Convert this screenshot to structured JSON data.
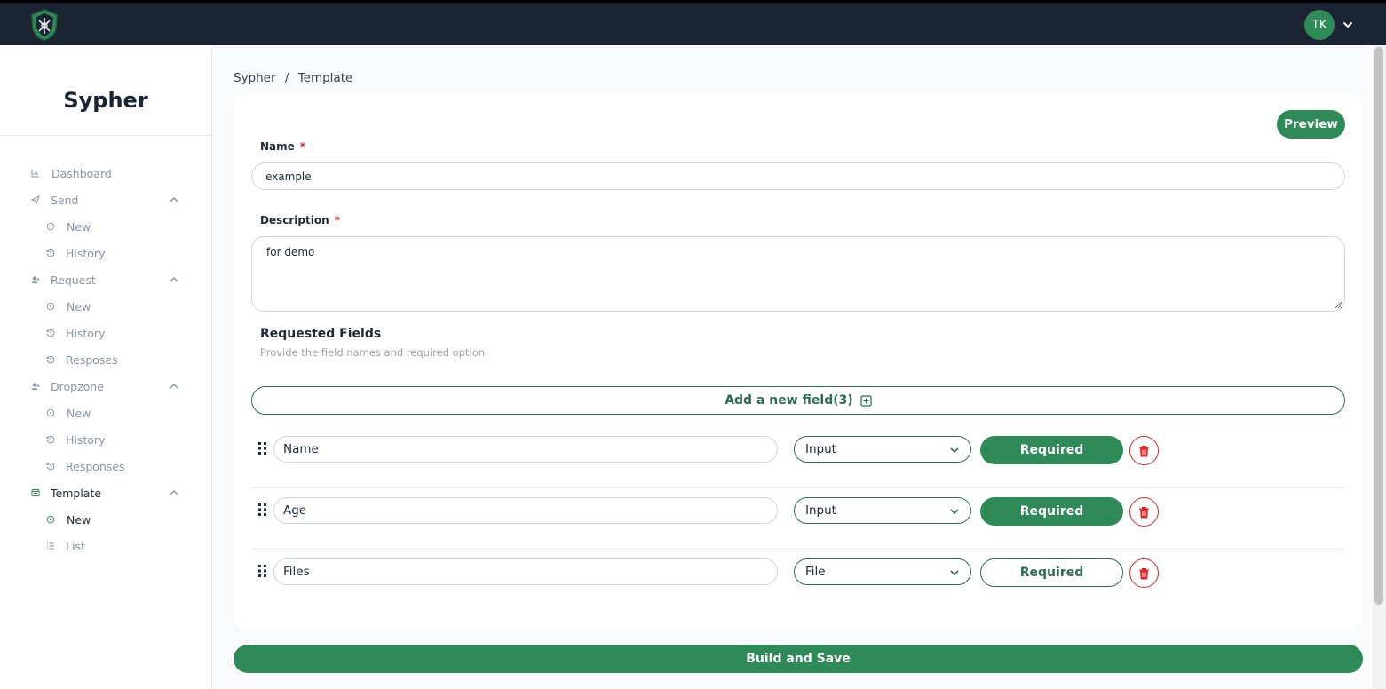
{
  "header": {
    "avatar_initials": "TK"
  },
  "sidebar": {
    "brand": "Sypher",
    "items": [
      {
        "label": "Dashboard",
        "icon": "chart-icon"
      },
      {
        "label": "Send",
        "icon": "send-icon"
      },
      {
        "label": "New",
        "icon": "plus-circle-icon"
      },
      {
        "label": "History",
        "icon": "history-icon"
      },
      {
        "label": "Request",
        "icon": "user-add-icon"
      },
      {
        "label": "New",
        "icon": "plus-circle-icon"
      },
      {
        "label": "History",
        "icon": "history-icon"
      },
      {
        "label": "Resposes",
        "icon": "history-icon"
      },
      {
        "label": "Dropzone",
        "icon": "user-add-icon"
      },
      {
        "label": "New",
        "icon": "plus-circle-icon"
      },
      {
        "label": "History",
        "icon": "history-icon"
      },
      {
        "label": "Responses",
        "icon": "history-icon"
      },
      {
        "label": "Template",
        "icon": "template-icon"
      },
      {
        "label": "New",
        "icon": "plus-circle-icon"
      },
      {
        "label": "List",
        "icon": "list-icon"
      }
    ]
  },
  "breadcrumb": {
    "root": "Sypher",
    "sep": "/",
    "current": "Template"
  },
  "form": {
    "preview_label": "Preview",
    "name_label": "Name",
    "name_value": "example",
    "description_label": "Description",
    "description_value": "for demo",
    "required_mark": "*",
    "section_title": "Requested Fields",
    "section_sub": "Provide the field names and required option",
    "add_field_label": "Add a new field(3)",
    "fields": [
      {
        "name": "Name",
        "type": "Input",
        "required_label": "Required",
        "required": true
      },
      {
        "name": "Age",
        "type": "Input",
        "required_label": "Required",
        "required": true
      },
      {
        "name": "Files",
        "type": "File",
        "required_label": "Required",
        "required": false
      }
    ],
    "build_label": "Build and Save"
  },
  "colors": {
    "accent": "#2e8b57",
    "topbar": "#1c2333",
    "danger": "#dc2626"
  }
}
